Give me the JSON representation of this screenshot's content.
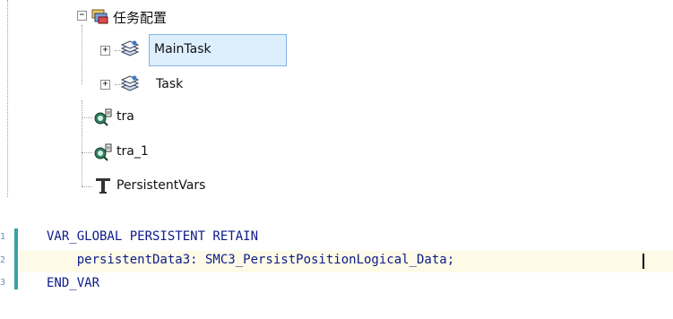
{
  "tree": {
    "root": {
      "label": "任务配置",
      "icon": "task-config-icon",
      "expander": "−"
    },
    "children": [
      {
        "label": "MainTask",
        "icon": "layers-icon",
        "expander": "+",
        "selected": true
      },
      {
        "label": "Task",
        "icon": "layers-icon",
        "expander": "+",
        "selected": false
      }
    ],
    "items": [
      {
        "label": "tra",
        "icon": "trace-icon"
      },
      {
        "label": "tra_1",
        "icon": "trace-icon"
      },
      {
        "label": "PersistentVars",
        "icon": "filter-funnel-icon"
      }
    ]
  },
  "editor": {
    "line_numbers": [
      "1",
      "2",
      "3"
    ],
    "lines": [
      "VAR_GLOBAL PERSISTENT RETAIN",
      "    persistentData3: SMC3_PersistPositionLogical_Data;",
      "END_VAR"
    ],
    "colors": {
      "keyword": "#0c1a8a",
      "current_line": "#fdfbe7",
      "gutter_bar": "#3aa0a0"
    }
  }
}
